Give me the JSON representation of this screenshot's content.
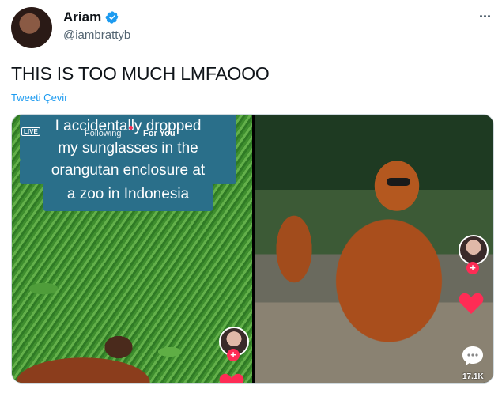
{
  "tweet": {
    "display_name": "Ariam",
    "handle": "@iambrattyb",
    "text": "THIS IS TOO MUCH LMFAOOO",
    "translate_label": "Tweeti Çevir"
  },
  "media": {
    "left": {
      "caption_lines": [
        "I accidentally dropped",
        "my sunglasses in the",
        "orangutan enclosure at",
        "a zoo in Indonesia"
      ],
      "live_label": "LIVE",
      "nav_following": "Following",
      "nav_for_you": "For You"
    },
    "right": {
      "comment_count": "17.1K"
    }
  },
  "colors": {
    "accent": "#1d9bf0",
    "tiktok_red": "#fe2c55"
  }
}
